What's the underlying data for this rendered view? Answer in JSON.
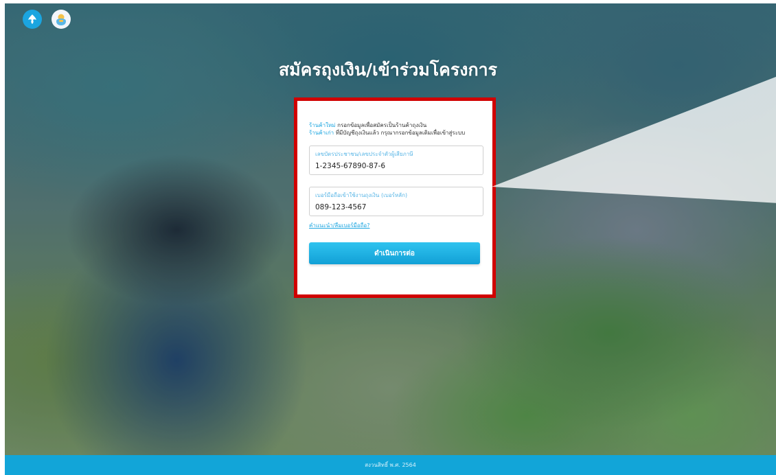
{
  "header": {
    "logos": [
      {
        "name": "krungthai-logo",
        "color": "#1ba5e0"
      },
      {
        "name": "tung-ngern-logo",
        "color": "#f2c14b"
      }
    ],
    "title": "สมัครถุงเงิน/เข้าร่วมโครงการ"
  },
  "form": {
    "info_new_tag": "ร้านค้าใหม่",
    "info_new_text": " กรอกข้อมูลเพื่อสมัครเป็นร้านค้าถุงเงิน",
    "info_old_tag": "ร้านค้าเก่า",
    "info_old_text": " ที่มีบัญชีถุงเงินแล้ว กรุณากรอกข้อมูลเดิมเพื่อเข้าสู่ระบบ",
    "id_label": "เลขบัตรประชาชน/เลขประจำตัวผู้เสียภาษี",
    "id_value": "1-2345-67890-87-6",
    "phone_label": "เบอร์มือถือเข้าใช้งานถุงเงิน (เบอร์หลัก)",
    "phone_value": "089-123-4567",
    "help_link": "คำแนะนำ/ลืมเบอร์มือถือ?",
    "continue_label": "ดำเนินการต่อ"
  },
  "footer": {
    "copyright": "สงวนสิทธิ์ พ.ศ. 2564"
  },
  "colors": {
    "accent": "#1ba5e0",
    "highlight_border": "#d10000",
    "footer_bg": "#12a5d8"
  }
}
